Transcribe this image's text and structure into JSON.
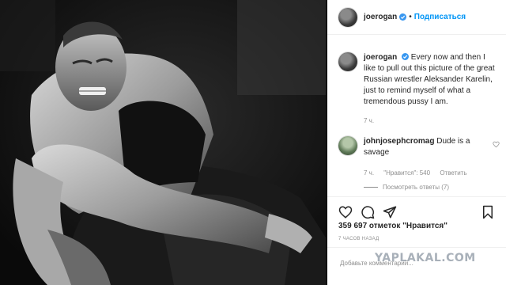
{
  "post": {
    "username": "joerogan",
    "follow_label": "Подписаться",
    "caption": "Every now and then I like to pull out this picture of the great Russian wrestler Aleksander Karelin, just to remind myself of what a tremendous pussy I am.",
    "caption_time": "7 ч."
  },
  "comments": [
    {
      "username": "johnjosephcromag",
      "text": "Dude is a savage",
      "time": "7 ч.",
      "likes": "\"Нравится\": 540",
      "reply_label": "Ответить",
      "view_replies": "Посмотреть ответы (7)"
    }
  ],
  "stats": {
    "likes": "359 697 отметок \"Нравится\"",
    "posted": "7 часов назад"
  },
  "add_comment": {
    "placeholder": "Добавьте комментарий..."
  },
  "watermark": "YAPLAKAL.COM",
  "icons": {
    "verified": "verified-badge-icon",
    "like": "heart-icon",
    "comment": "comment-bubble-icon",
    "share": "paper-plane-icon",
    "save": "bookmark-icon"
  },
  "colors": {
    "accent": "#0095f6",
    "verified": "#3897f0",
    "muted": "#8e8e8e"
  }
}
